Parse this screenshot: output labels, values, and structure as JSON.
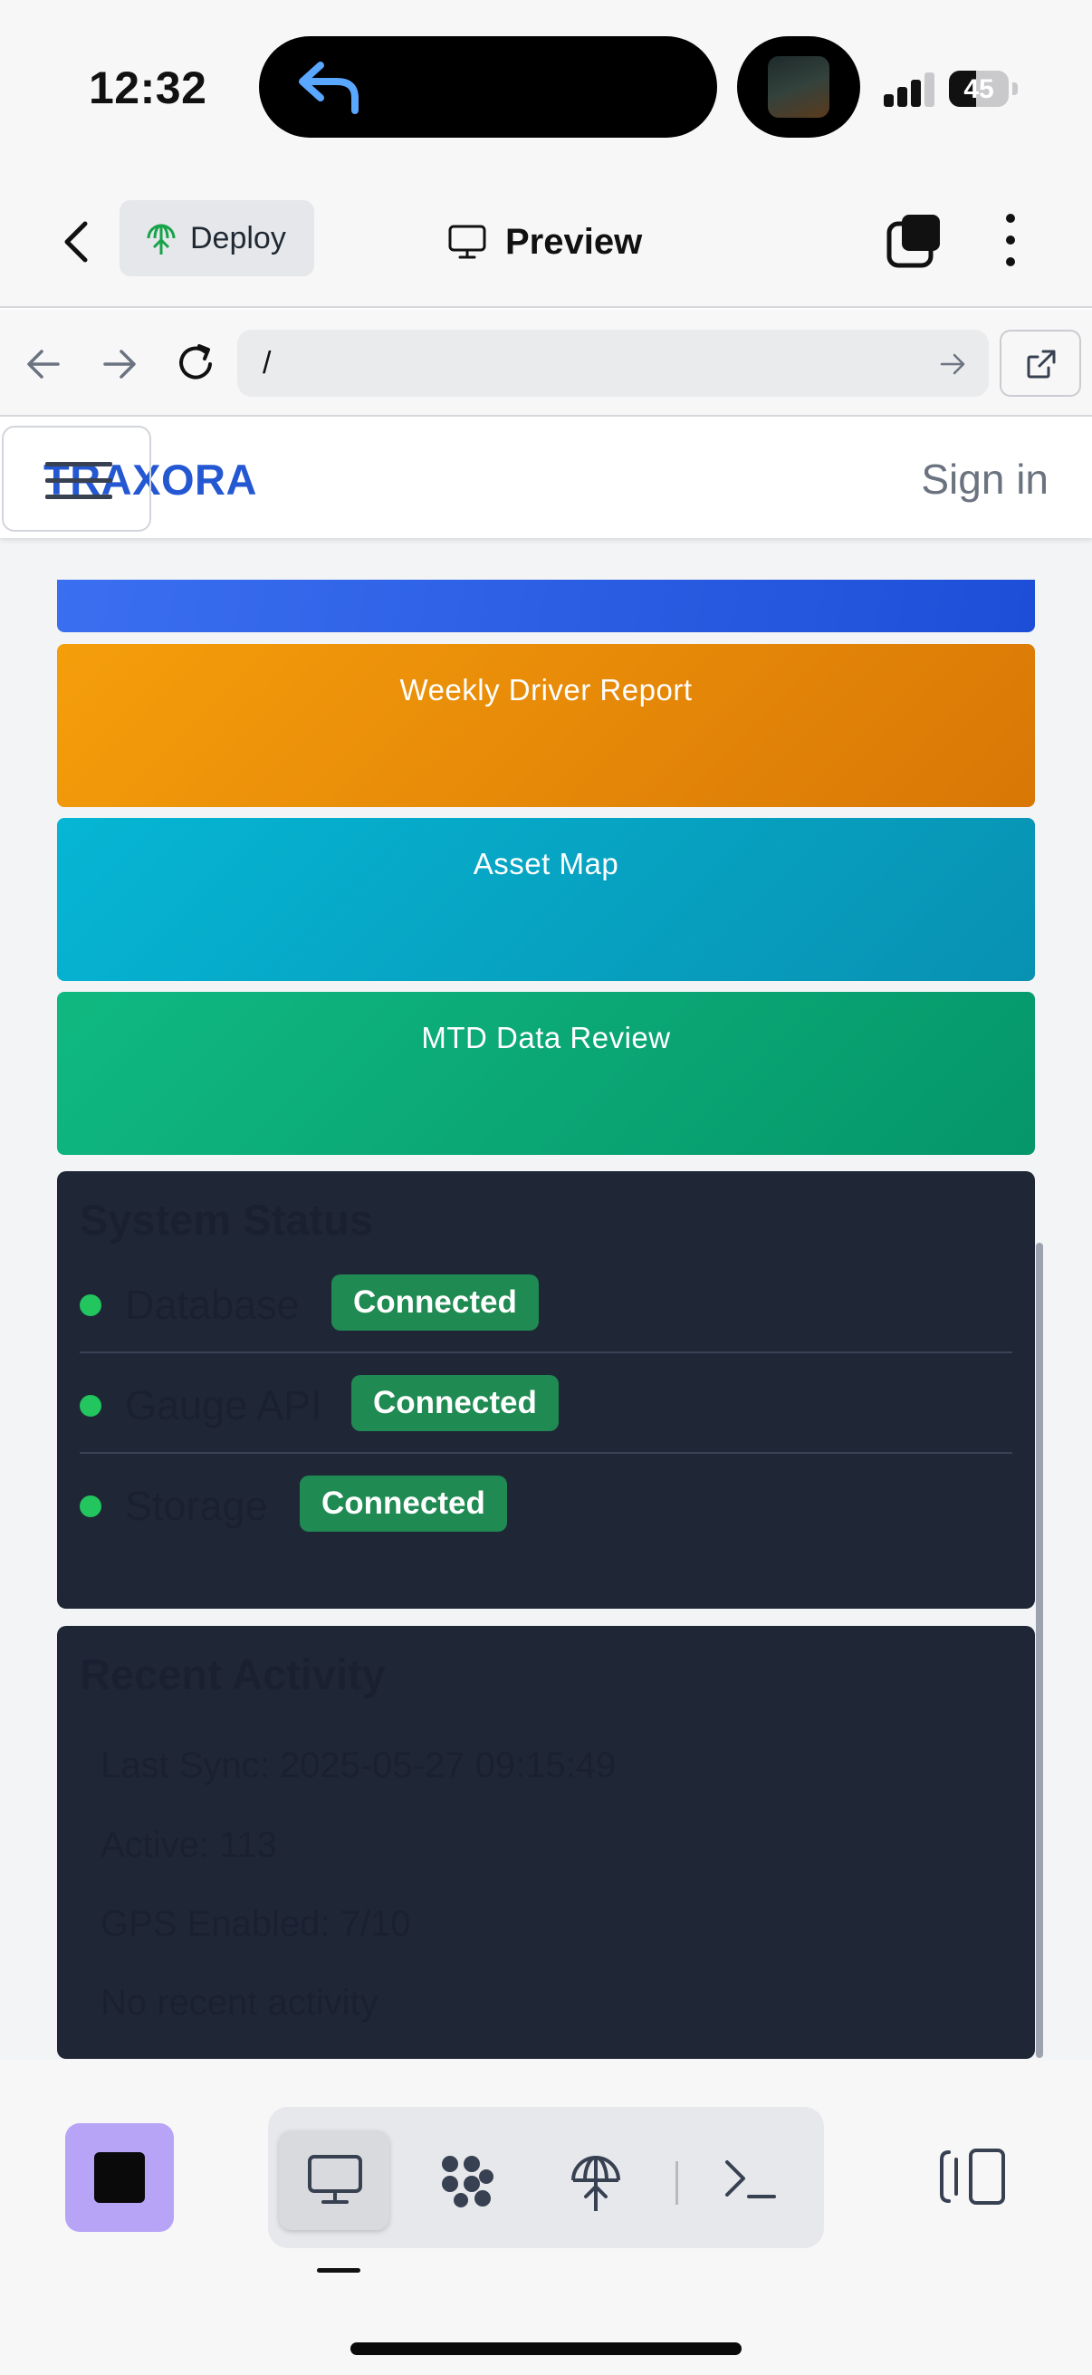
{
  "status_bar": {
    "time": "12:32",
    "battery_level": "45",
    "signal_bars": 3
  },
  "toolbar": {
    "deploy_label": "Deploy",
    "preview_label": "Preview"
  },
  "browser": {
    "url": "/"
  },
  "site": {
    "brand": "TRAXORA",
    "signin_label": "Sign in"
  },
  "tiles": [
    {
      "label": "Weekly Driver Report",
      "color": "#f59e0b"
    },
    {
      "label": "Asset Map",
      "color": "#06b6d4"
    },
    {
      "label": "MTD Data Review",
      "color": "#10b981"
    }
  ],
  "system_status": {
    "title": "System Status",
    "items": [
      {
        "label": "Database",
        "status": "Connected"
      },
      {
        "label": "Gauge API",
        "status": "Connected"
      },
      {
        "label": "Storage",
        "status": "Connected"
      }
    ]
  },
  "recent_activity": {
    "title": "Recent Activity",
    "lines": [
      "Last Sync: 2025-05-27 09:15:49",
      "Active: 113",
      "GPS Enabled: 7/10",
      "No recent activity"
    ]
  },
  "colors": {
    "brand": "#2458d3",
    "panel_bg": "#1f2737",
    "badge_bg": "#1f8a52",
    "stop_button": "#b8a4f7"
  },
  "icons": [
    "reply-arrow-icon",
    "back-chevron-icon",
    "deploy-icon",
    "monitor-icon",
    "tabs-icon",
    "more-vertical-icon",
    "nav-back-icon",
    "nav-forward-icon",
    "reload-icon",
    "go-arrow-icon",
    "external-link-icon",
    "menu-icon",
    "stop-icon",
    "desktop-icon",
    "workflow-icon",
    "deploy-tool-icon",
    "terminal-icon",
    "split-panel-icon"
  ]
}
